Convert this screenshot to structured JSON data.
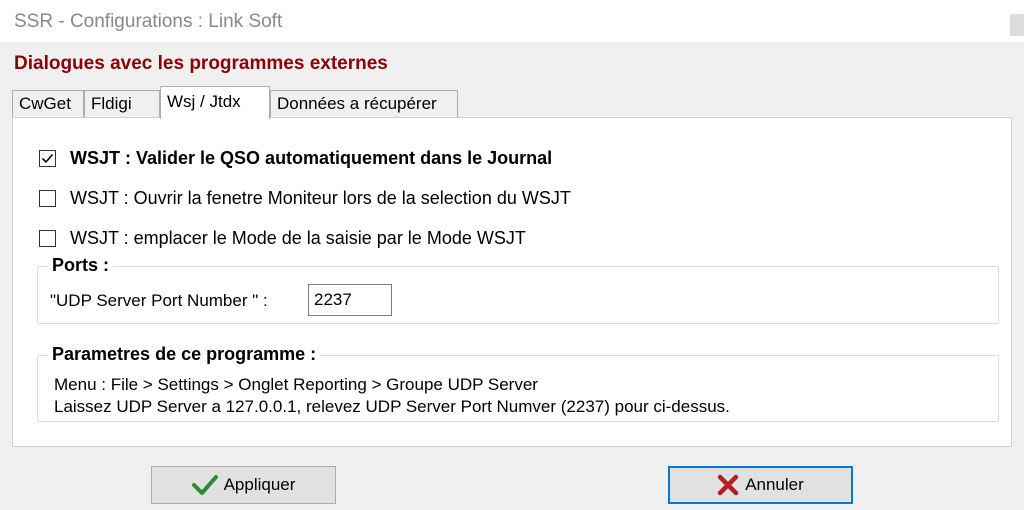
{
  "window": {
    "title": "SSR - Configurations : Link Soft"
  },
  "dialog": {
    "heading": "Dialogues avec les programmes externes"
  },
  "tabs": [
    {
      "label": "CwGet",
      "active": false
    },
    {
      "label": "Fldigi",
      "active": false
    },
    {
      "label": "Wsj / Jtdx",
      "active": true
    },
    {
      "label": "Données a récupérer",
      "active": false
    }
  ],
  "options": [
    {
      "label": "WSJT : Valider le QSO automatiquement dans le  Journal",
      "checked": true
    },
    {
      "label": "WSJT : Ouvrir la fenetre Moniteur lors de la selection du WSJT",
      "checked": false
    },
    {
      "label": "WSJT : emplacer le Mode de la saisie par le Mode WSJT",
      "checked": false
    }
  ],
  "ports": {
    "title": "Ports :",
    "label": "\"UDP Server Port Number  \" :",
    "value": "2237"
  },
  "params": {
    "title": "Parametres de ce programme :",
    "line1": "Menu : File > Settings > Onglet Reporting > Groupe UDP Server",
    "line2": "Laissez UDP Server a 127.0.0.1, relevez UDP Server Port Numver (2237) pour ci-dessus."
  },
  "buttons": {
    "apply": {
      "label": "Appliquer",
      "icon": "checkmark-icon",
      "color": "#2e8b2e"
    },
    "cancel": {
      "label": "Annuler",
      "icon": "x-icon",
      "color": "#b22222"
    }
  },
  "colors": {
    "heading": "#8b0000",
    "accent": "#0078d7"
  }
}
